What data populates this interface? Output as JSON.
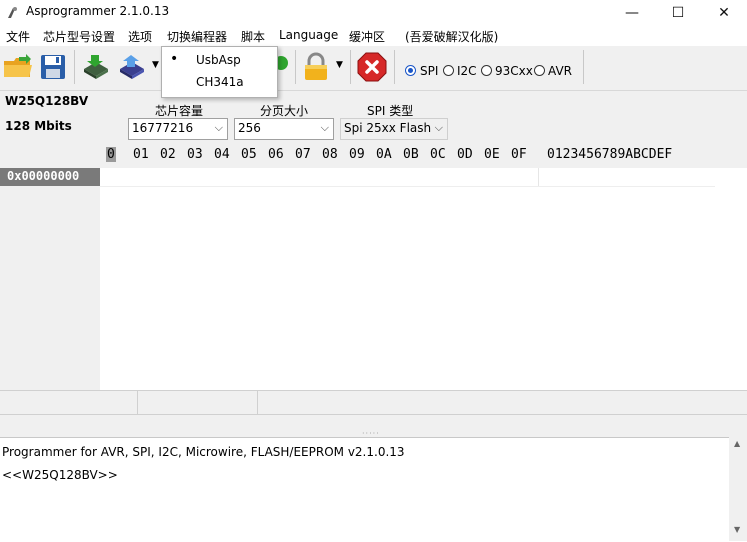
{
  "window": {
    "title": "Asprogrammer 2.1.0.13",
    "minimize_glyph": "—",
    "maximize_glyph": "☐",
    "close_glyph": "✕"
  },
  "menu": {
    "items": [
      "文件",
      "芯片型号设置",
      "选项",
      "切换编程器",
      "脚本",
      "Language",
      "缓冲区",
      "(吾爱破解汉化版)"
    ]
  },
  "programmer_menu": {
    "items": [
      {
        "label": "UsbAsp",
        "selected": true
      },
      {
        "label": "CH341a",
        "selected": false
      }
    ],
    "bullet": "•"
  },
  "toolbar": {
    "icons": [
      "open-folder-icon",
      "save-disk-icon",
      "read-chip-icon",
      "write-chip-icon",
      "verify-chip-icon",
      "lock-icon",
      "stop-icon"
    ],
    "protocols": [
      {
        "label": "SPI",
        "selected": true
      },
      {
        "label": "I2C",
        "selected": false
      },
      {
        "label": "93Cxx",
        "selected": false
      },
      {
        "label": "AVR",
        "selected": false
      }
    ]
  },
  "chip": {
    "name": "W25Q128BV",
    "size": "128 Mbits",
    "capacity_label": "芯片容量",
    "capacity_value": "16777216",
    "page_label": "分页大小",
    "page_value": "256",
    "spi_type_label": "SPI 类型",
    "spi_type_value": "Spi 25xx Flash"
  },
  "hex_view": {
    "cursor_digit": "0",
    "columns": [
      "0",
      "01",
      "02",
      "03",
      "04",
      "05",
      "06",
      "07",
      "08",
      "09",
      "0A",
      "0B",
      "0C",
      "0D",
      "0E",
      "0F"
    ],
    "ascii_header": "0123456789ABCDEF",
    "rows": [
      {
        "address": "0x00000000"
      }
    ]
  },
  "log": {
    "lines": [
      "Programmer for AVR, SPI, I2C, Microwire, FLASH/EEPROM v2.1.0.13",
      "<<W25Q128BV>>"
    ]
  },
  "colors": {
    "radio_accent": "#1a56c8",
    "stop_red": "#d62828",
    "address_bg": "#7a7a7a"
  }
}
